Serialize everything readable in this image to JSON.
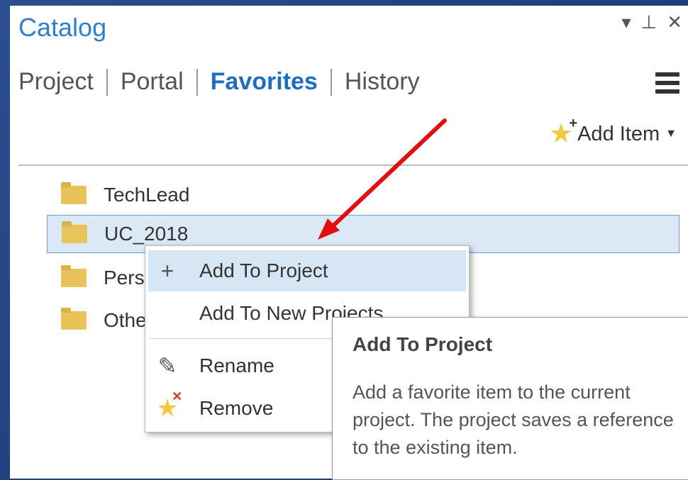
{
  "panel": {
    "title": "Catalog",
    "window_controls": {
      "menu": "▾",
      "pin": "⊥",
      "close": "✕"
    }
  },
  "tabs": [
    {
      "label": "Project",
      "active": false
    },
    {
      "label": "Portal",
      "active": false
    },
    {
      "label": "Favorites",
      "active": true
    },
    {
      "label": "History",
      "active": false
    }
  ],
  "toolbar": {
    "add_item_label": "Add Item"
  },
  "tree_items": [
    {
      "label": "TechLead",
      "selected": false
    },
    {
      "label": "UC_2018",
      "selected": true
    },
    {
      "label": "Pers",
      "selected": false
    },
    {
      "label": "Othe",
      "selected": false
    }
  ],
  "context_menu": {
    "items": [
      {
        "label": "Add To Project",
        "icon": "plus-icon",
        "highlighted": true
      },
      {
        "label": "Add To New Projects",
        "icon": "",
        "highlighted": false
      },
      {
        "label": "Rename",
        "icon": "pencil-icon",
        "highlighted": false
      },
      {
        "label": "Remove",
        "icon": "remove-favorite-icon",
        "highlighted": false
      }
    ]
  },
  "tooltip": {
    "title": "Add To Project",
    "body": "Add a favorite item to the current project. The project saves a reference to the existing item."
  },
  "colors": {
    "accent": "#2f7fd0",
    "favorites_tab": "#1a6fc0",
    "selection_bg": "#dbe8f6",
    "annotation_arrow": "#e01010",
    "frame": "#1f3f7a"
  }
}
